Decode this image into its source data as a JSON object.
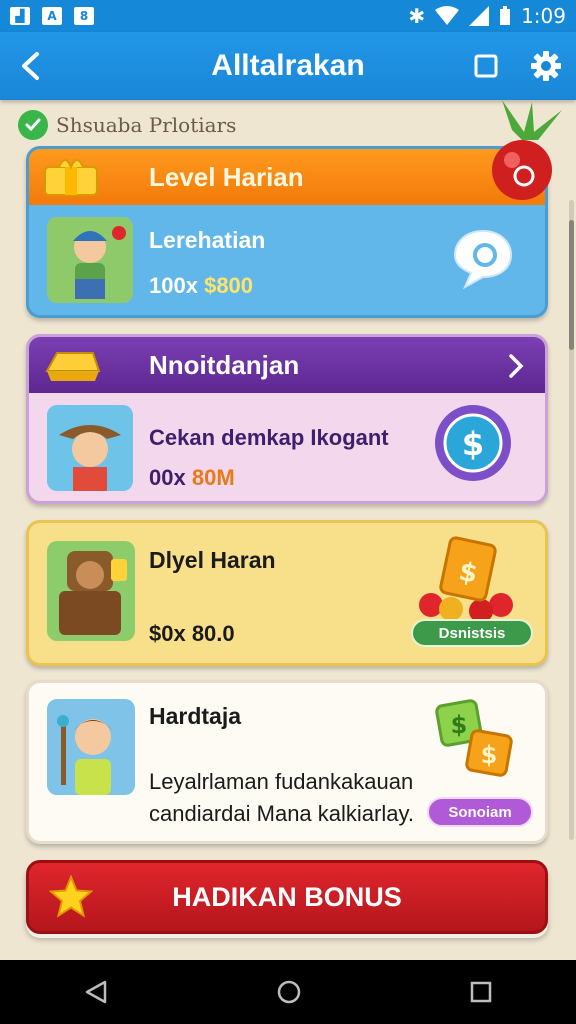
{
  "status_bar": {
    "time": "1:09"
  },
  "app_bar": {
    "title": "Alltalrakan"
  },
  "subheader": {
    "text": "Shsuaba Prlotiars"
  },
  "cards": [
    {
      "header": "Level Harian",
      "title": "Lerehatian",
      "value_a": "100x",
      "value_b": "$800"
    },
    {
      "header": "Nnoitdanjan",
      "title": "Cekan demkap Ikogant",
      "value_a": "00x",
      "value_b": "80M"
    },
    {
      "title": "Dlyel Haran",
      "value": "$0x  80.0",
      "badge": "Dsnistsis"
    },
    {
      "title": "Hardtaja",
      "line1": "Leyalrlaman fudankakauan",
      "line2": "candiardai Mana kalkiarlay.",
      "badge": "Sonoiam"
    }
  ],
  "bonus_button": {
    "label": "HADIKAN BONUS"
  },
  "colors": {
    "primary": "#1a86d6",
    "orange": "#f27a0a",
    "purple": "#5d2791",
    "bonus": "#d01f26"
  }
}
